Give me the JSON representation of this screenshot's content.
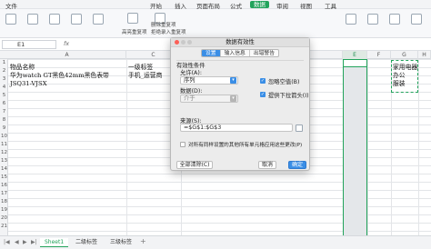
{
  "menubar": {
    "items": [
      "文件",
      "开始",
      "插入",
      "页面布局",
      "公式",
      "数据",
      "审阅",
      "视图",
      "工具"
    ],
    "active_index": 5,
    "accent_color": "#22a35b"
  },
  "ribbon": {
    "labels": [
      "数据透视表",
      "重复项",
      "高亮重复项",
      "拒绝录入重复项",
      "删除重复项"
    ]
  },
  "formula_bar": {
    "cell_ref": "E1",
    "fx": "fx"
  },
  "grid": {
    "columns": [
      "A",
      "B",
      "C",
      "D",
      "E",
      "F",
      "G",
      "H"
    ],
    "selected_column": "E",
    "rows": [
      "1",
      "2",
      "3",
      "4",
      "5",
      "6",
      "7",
      "8",
      "9",
      "10",
      "11",
      "12",
      "13",
      "14",
      "15",
      "16",
      "17",
      "18",
      "19",
      "20",
      "21"
    ],
    "cells": {
      "A1": "物品名称",
      "A2": "华为watch GT黑色42mm黑色表带",
      "A3": "JSQ31-VJSX",
      "C1": "一级标签",
      "C2": "手机_运营商",
      "G1": "家用电器",
      "G2": "办公",
      "G3": "服装"
    }
  },
  "sheet_tabs": {
    "tabs": [
      "Sheet1",
      "二级标签",
      "三级标签"
    ],
    "active_index": 0
  },
  "dialog": {
    "title": "数据有效性",
    "tabs": [
      "设置",
      "输入信息",
      "出错警告"
    ],
    "active_tab": 0,
    "section_label": "有效性条件",
    "allow_label": "允许(A):",
    "allow_value": "序列",
    "ignore_blank_label": "忽略空值(B)",
    "ignore_blank_checked": true,
    "data_label": "数据(D):",
    "data_value": "介于",
    "dropdown_label": "提供下拉箭头(I)",
    "dropdown_checked": true,
    "source_label": "来源(S):",
    "source_value": "=$G$1:$G$3",
    "apply_all_label": "对所有同样设置的其他所有单元格应用这些更改(P)",
    "apply_all_checked": false,
    "clear_button": "全部清除(C)",
    "cancel_button": "取消",
    "ok_button": "确定",
    "primary_color": "#3a8ee6"
  }
}
